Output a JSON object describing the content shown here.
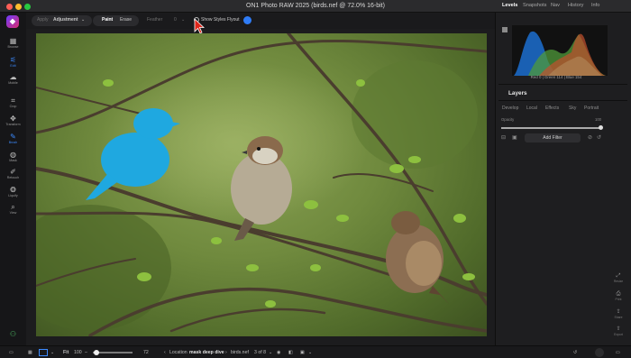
{
  "window": {
    "title": "ON1 Photo RAW 2025 (birds.nef @ 72.0% 16-bit)"
  },
  "left_tools": [
    {
      "label": "Browse",
      "icon": "browse-icon"
    },
    {
      "label": "Edit",
      "icon": "edit-icon"
    },
    {
      "label": "Mobile",
      "icon": "mobile-icon"
    },
    {
      "label": "Crop",
      "icon": "crop-icon"
    },
    {
      "label": "Transform",
      "icon": "transform-icon"
    },
    {
      "label": "Brush",
      "icon": "brush-icon"
    },
    {
      "label": "Mask",
      "icon": "mask-icon"
    },
    {
      "label": "Retouch",
      "icon": "retouch-icon"
    },
    {
      "label": "Liquify",
      "icon": "liquify-icon"
    },
    {
      "label": "View",
      "icon": "view-icon"
    }
  ],
  "options": {
    "apply_label": "Apply",
    "apply_value": "Adjustment",
    "paint": "Paint",
    "erase": "Erase",
    "feather_label": "Feather",
    "feather_value": "0",
    "show_styles": "Show Styles Flyout"
  },
  "panel": {
    "tabs": [
      "Levels",
      "Snapshots",
      "Nav",
      "History",
      "Info"
    ],
    "histogram_readout": "Red  0  |  Green 114  |  Blue 154",
    "layers_title": "Layers",
    "layer_tabs": [
      "Develop",
      "Local",
      "Effects",
      "Sky",
      "Portrait"
    ],
    "opacity_label": "Opacity",
    "opacity_value": "100",
    "add_filter": "Add Filter"
  },
  "right_icons": [
    {
      "label": "Resize"
    },
    {
      "label": "Print"
    },
    {
      "label": "Share"
    },
    {
      "label": "Export"
    }
  ],
  "bottom": {
    "fit": "Fit",
    "zoom_value": "100",
    "zoom_readout": "72",
    "location_label": "Location",
    "location_value": "mask deep dive",
    "filename": "birds.nef",
    "count": "3 of 8"
  },
  "colors": {
    "accent": "#2f7cf6",
    "mask_blue": "#1fa8e0"
  }
}
